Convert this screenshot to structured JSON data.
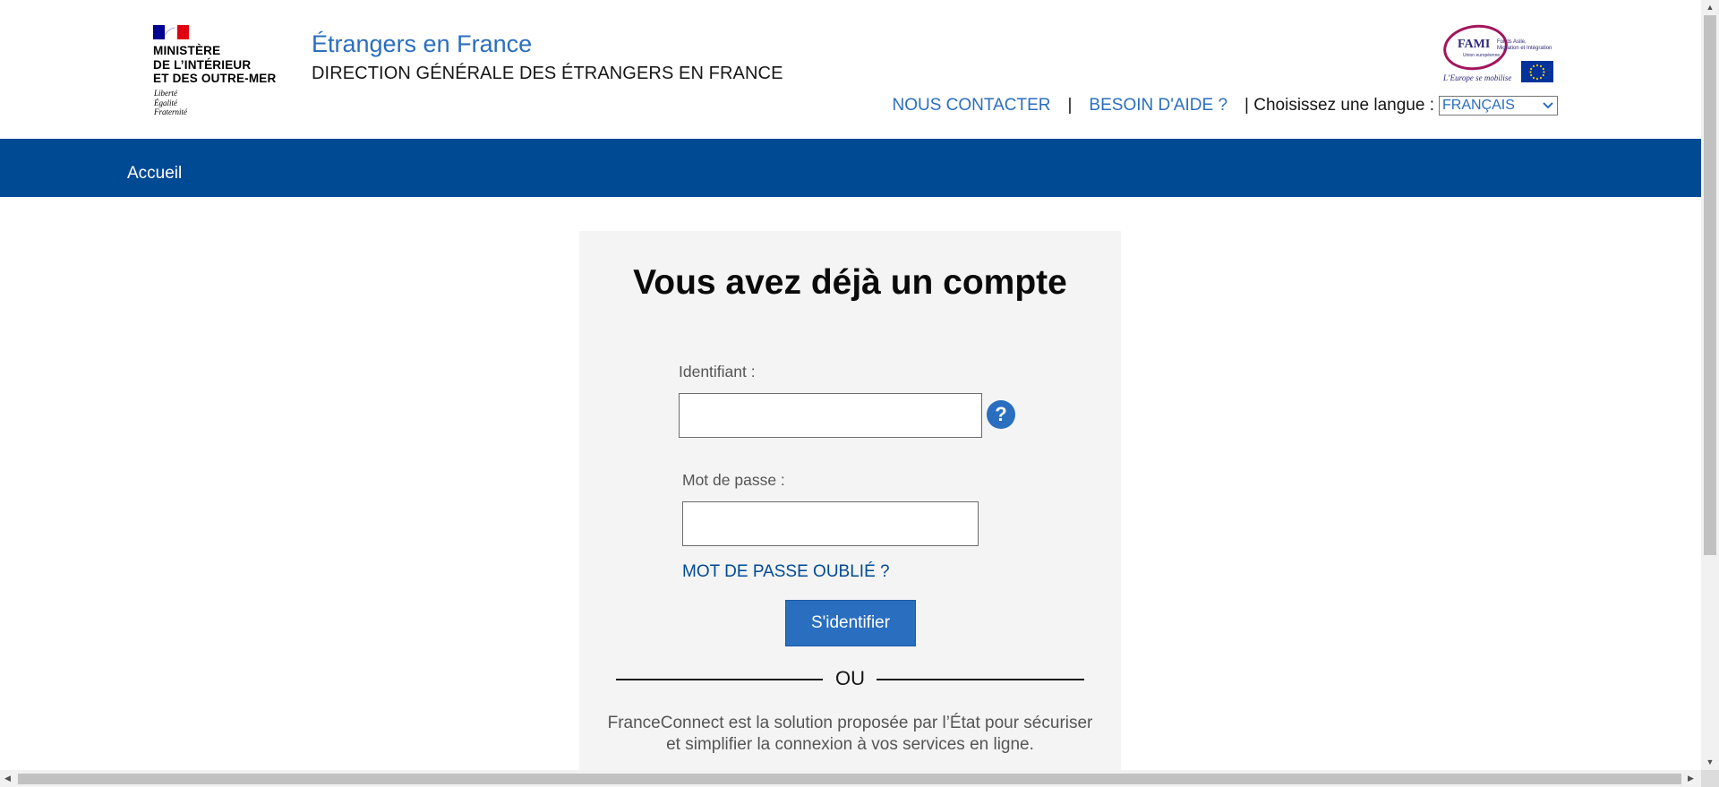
{
  "header": {
    "ministry_lines": [
      "MINISTÈRE",
      "DE L’INTÉRIEUR",
      "ET DES OUTRE-MER"
    ],
    "motto_lines": [
      "Liberté",
      "Égalité",
      "Fraternité"
    ],
    "site_title": "Étrangers en France",
    "site_subtitle": "DIRECTION GÉNÉRALE DES ÉTRANGERS EN FRANCE",
    "fami": {
      "word": "FAMI",
      "desc_lines": [
        "Fonds Asile,",
        "Migration et Intégration"
      ],
      "ue": "Union européenne",
      "motto": "L’Europe se mobilise"
    },
    "links": {
      "contact": "NOUS CONTACTER",
      "separator": "|",
      "help": "BESOIN D'AIDE ?",
      "language_label": "| Choisissez une langue :",
      "language_value": "FRANÇAIS"
    }
  },
  "nav": {
    "home": "Accueil"
  },
  "login": {
    "title": "Vous avez déjà un compte",
    "identifier_label": "Identifiant :",
    "identifier_value": "",
    "help_symbol": "?",
    "password_label": "Mot de passe :",
    "password_value": "",
    "forgot": "MOT DE PASSE OUBLIÉ ?",
    "submit": "S'identifier",
    "or": "OU",
    "franceconnect_lines": [
      "FranceConnect est la solution proposée par l’État pour sécuriser",
      "et simplifier la connexion à vos services en ligne."
    ]
  },
  "colors": {
    "brand_blue": "#004a94",
    "link_blue": "#2a6ebf",
    "card_bg": "#f4f4f4"
  }
}
